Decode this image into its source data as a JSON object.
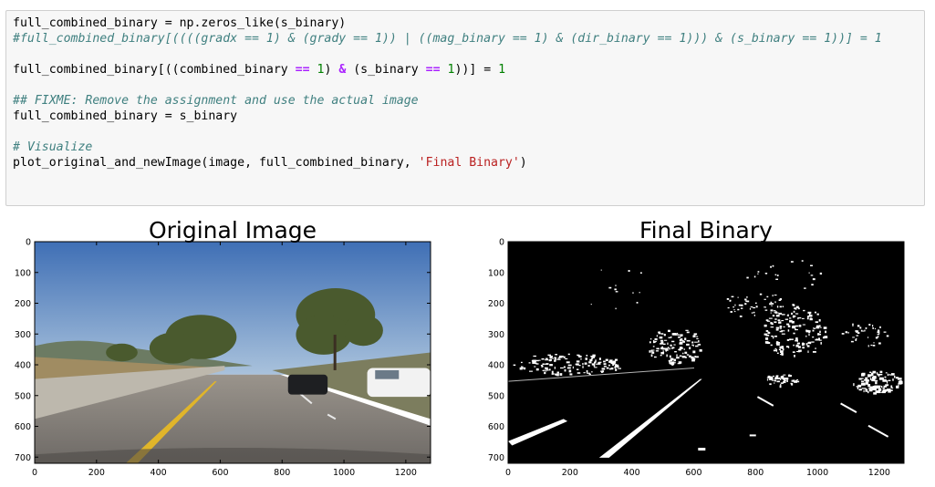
{
  "code_cell": {
    "lines": [
      [
        {
          "t": "full_combined_binary = np.zeros_like(s_binary)"
        }
      ],
      [
        {
          "t": "#full_combined_binary[((((gradx == 1) & (grady == 1)) | ((mag_binary == 1) & (dir_binary == 1))) & (s_binary == 1))] = 1",
          "c": "tok-comment"
        }
      ],
      [
        {
          "t": ""
        }
      ],
      [
        {
          "t": "full_combined_binary[((combined_binary "
        },
        {
          "t": "==",
          "c": "tok-op"
        },
        {
          "t": " "
        },
        {
          "t": "1",
          "c": "tok-num"
        },
        {
          "t": ") "
        },
        {
          "t": "&",
          "c": "tok-op"
        },
        {
          "t": " (s_binary "
        },
        {
          "t": "==",
          "c": "tok-op"
        },
        {
          "t": " "
        },
        {
          "t": "1",
          "c": "tok-num"
        },
        {
          "t": "))] = "
        },
        {
          "t": "1",
          "c": "tok-num"
        }
      ],
      [
        {
          "t": ""
        }
      ],
      [
        {
          "t": "## FIXME: Remove the assignment and use the actual image",
          "c": "tok-comment"
        }
      ],
      [
        {
          "t": "full_combined_binary = s_binary"
        }
      ],
      [
        {
          "t": ""
        }
      ],
      [
        {
          "t": "# Visualize",
          "c": "tok-comment"
        }
      ],
      [
        {
          "t": "plot_original_and_newImage(image, full_combined_binary, "
        },
        {
          "t": "'Final Binary'",
          "c": "tok-str"
        },
        {
          "t": ")"
        }
      ]
    ]
  },
  "figures": {
    "left": {
      "title": "Original Image",
      "x_ticks": [
        "0",
        "200",
        "400",
        "600",
        "800",
        "1000",
        "1200"
      ],
      "y_ticks": [
        "0",
        "100",
        "200",
        "300",
        "400",
        "500",
        "600",
        "700"
      ],
      "sky_color": "#5a86c0",
      "road_color": "#8a8580",
      "lane_color": "#e0b52a",
      "tree_color": "#4a5a2e"
    },
    "right": {
      "title": "Final Binary",
      "x_ticks": [
        "0",
        "200",
        "400",
        "600",
        "800",
        "1000",
        "1200"
      ],
      "y_ticks": [
        "0",
        "100",
        "200",
        "300",
        "400",
        "500",
        "600",
        "700"
      ]
    }
  }
}
